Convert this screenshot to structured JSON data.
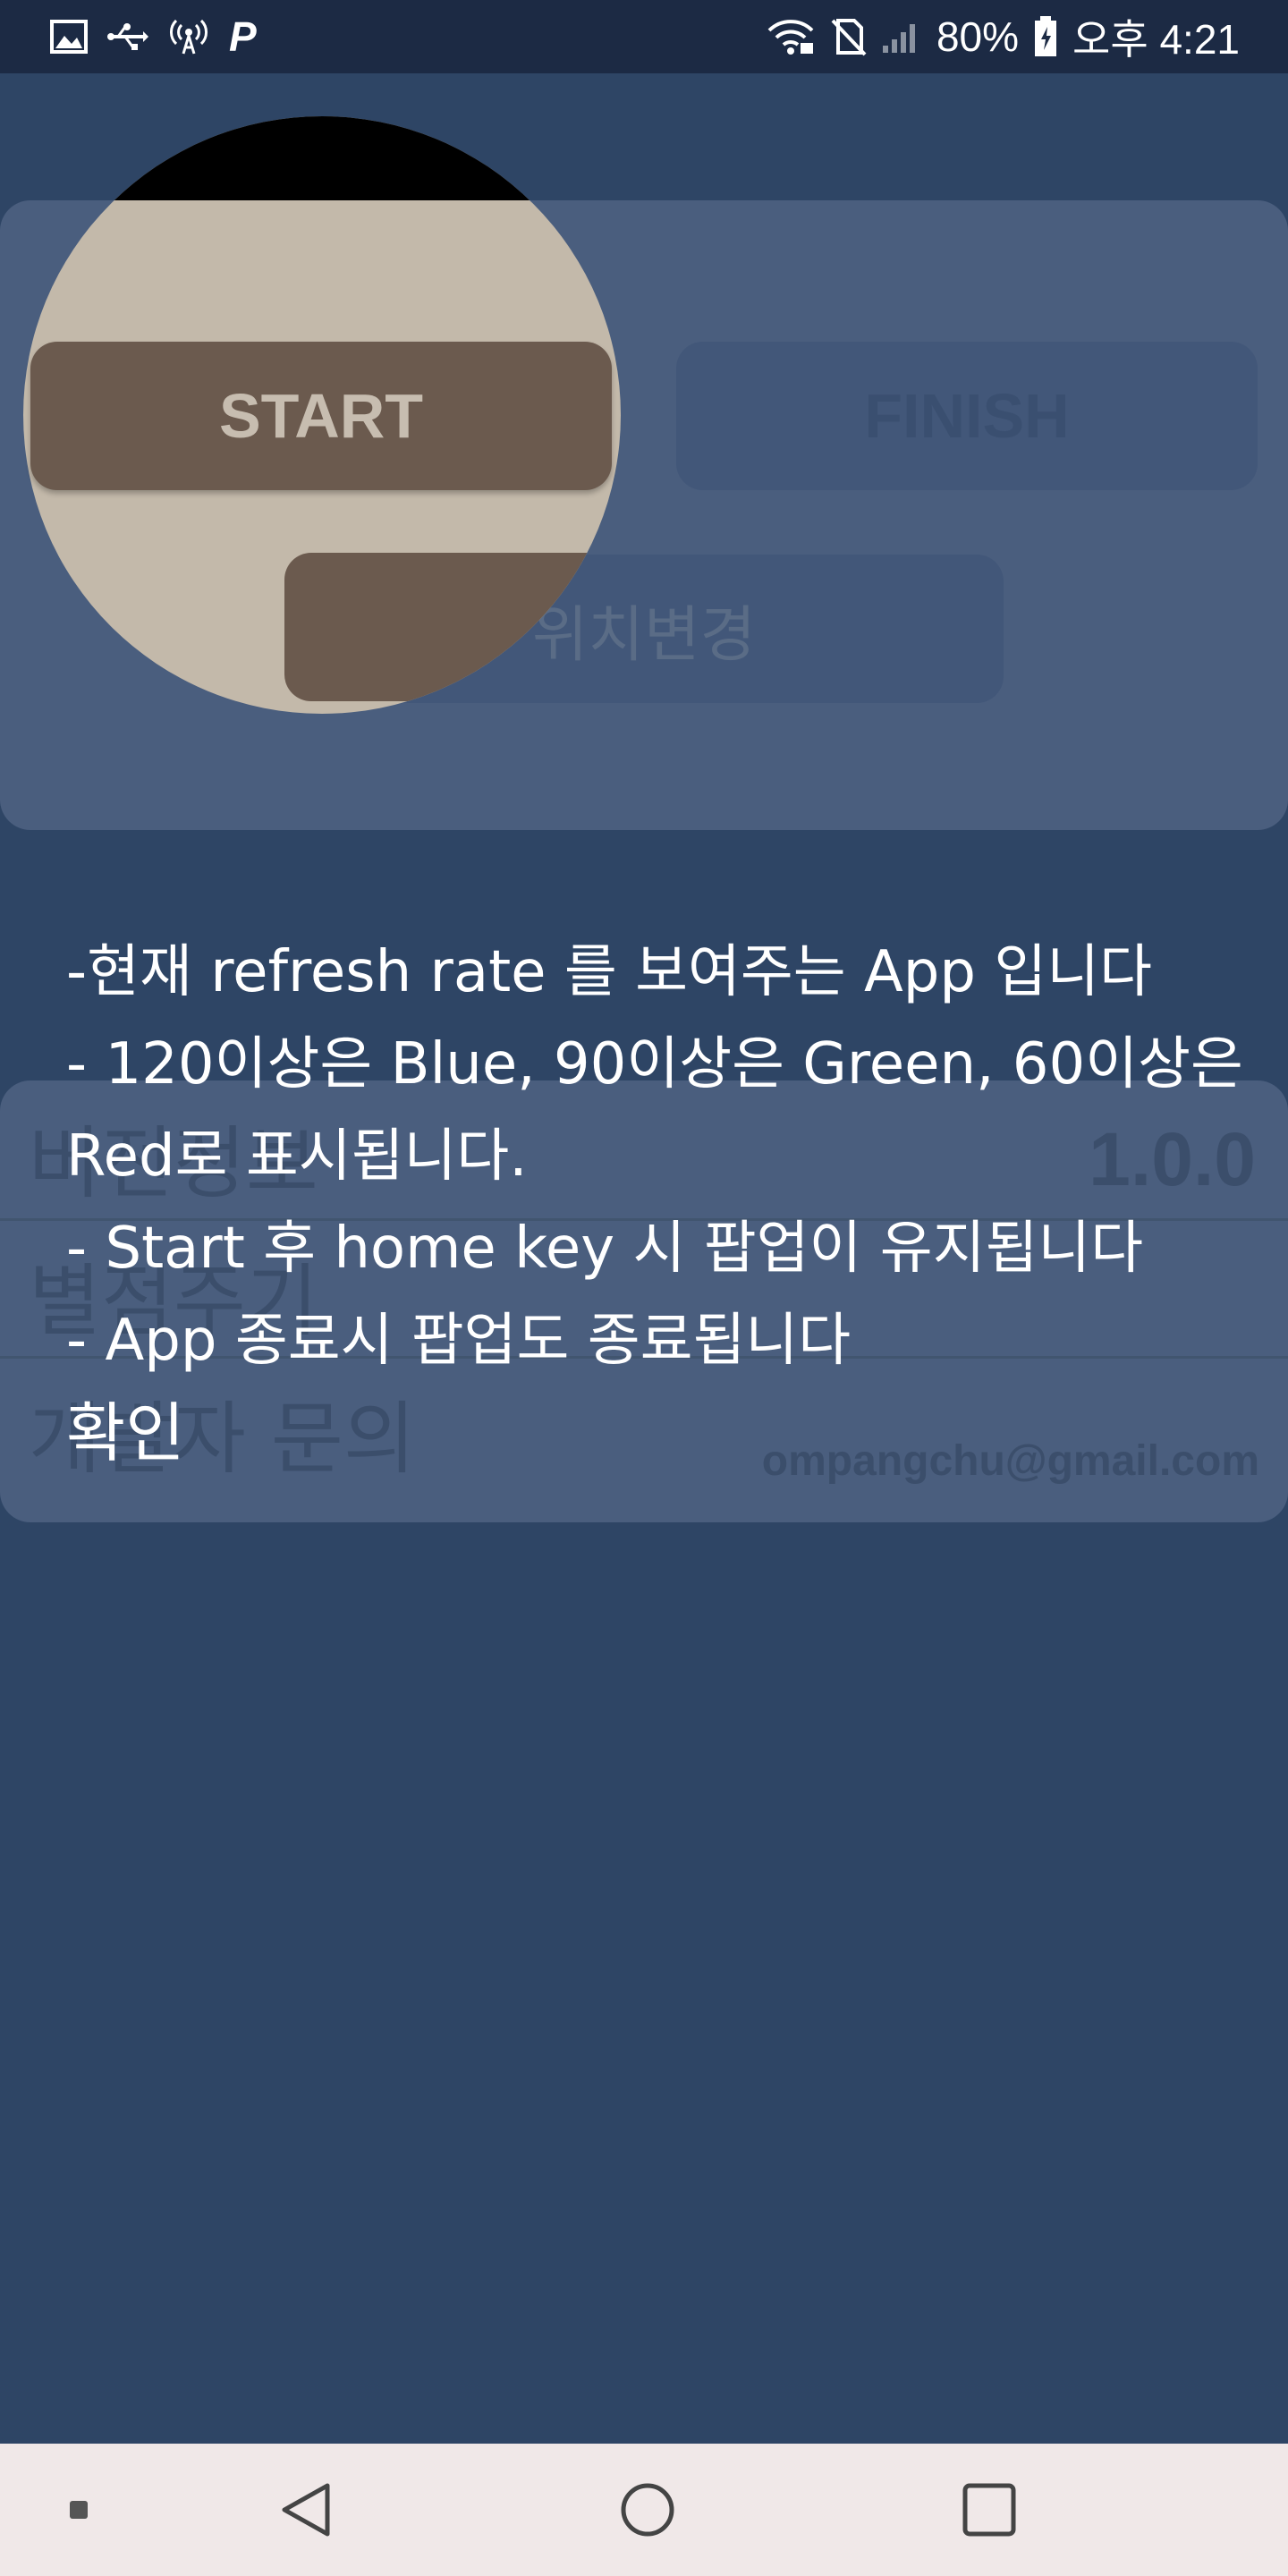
{
  "status_bar": {
    "left_icons": [
      "image-icon",
      "usb-icon",
      "hotspot-icon",
      "p-app-icon"
    ],
    "p_glyph": "P",
    "right_icons": [
      "wifi-icon",
      "no-sim-icon",
      "signal-icon",
      "battery-charging-icon"
    ],
    "battery": "80%",
    "time": "오후 4:21"
  },
  "top_card": {
    "start_label": "START",
    "finish_label": "FINISH",
    "move_label": "위치변경"
  },
  "info_card": {
    "version_label": "버전정보",
    "version_value": "1.0.0",
    "rating_label": "별점주기",
    "contact_label": "개발자 문의",
    "contact_email": "ompangchu@gmail.com"
  },
  "dialog": {
    "lines": [
      "-현재 refresh rate 를 보여주는 App 입니다",
      "- 120이상은 Blue, 90이상은 Green, 60이상은",
      "Red로 표시됩니다.",
      "- Start 후 home key 시 팝업이 유지됩니다",
      "- App 종료시 팝업도 종료됩니다"
    ],
    "confirm_label": "확인"
  },
  "nav_bar": {
    "icons": [
      "small-square-icon",
      "back-icon",
      "home-icon",
      "recents-icon"
    ]
  },
  "colors": {
    "background": "#2e4565",
    "card": "#4a5e7e",
    "status_bar": "#1c2a44",
    "start_button": "#6b5a4e",
    "nav_bar": "#f0e8e8"
  }
}
